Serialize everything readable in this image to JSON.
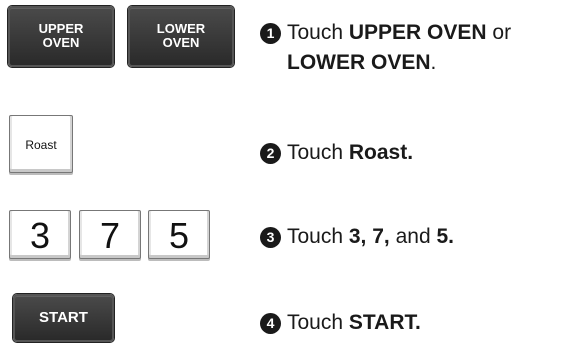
{
  "buttons": {
    "upper_oven": {
      "line1": "UPPER",
      "line2": "OVEN"
    },
    "lower_oven": {
      "line1": "LOWER",
      "line2": "OVEN"
    },
    "roast": "Roast",
    "digits": [
      "3",
      "7",
      "5"
    ],
    "start": "START"
  },
  "steps": [
    {
      "number": "1",
      "prefix": "Touch ",
      "bold1": "UPPER OVEN",
      "middle": " or",
      "bold2": "LOWER OVEN",
      "suffix": "."
    },
    {
      "number": "2",
      "prefix": "Touch ",
      "bold1": "Roast."
    },
    {
      "number": "3",
      "prefix": "Touch ",
      "bold1": "3, 7,",
      "middle": " and ",
      "bold2": "5."
    },
    {
      "number": "4",
      "prefix": "Touch ",
      "bold1": "START."
    }
  ],
  "colors": {
    "dark_button": "#2a2a2a",
    "text": "#1a1a1a"
  }
}
